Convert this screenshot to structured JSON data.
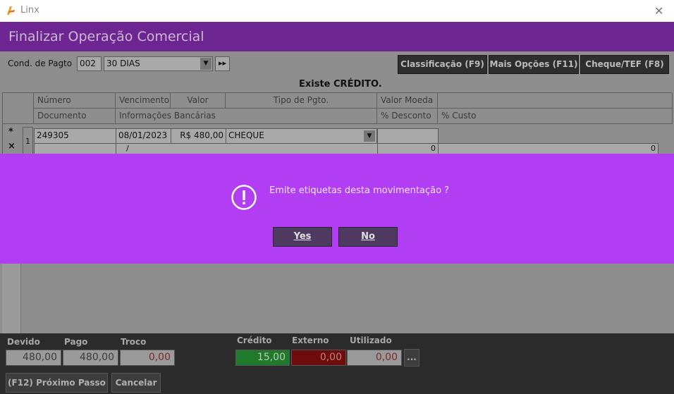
{
  "window": {
    "app_title": "Linx",
    "close_glyph": "✕",
    "logo_icon": "linx-logo-icon"
  },
  "header": {
    "title": "Finalizar Operação Comercial"
  },
  "toolbar": {
    "cond_label": "Cond. de Pagto",
    "cond_code": "002",
    "cond_value": "30 DIAS",
    "dropdown_glyph": "▼",
    "next_glyph": "▸▸",
    "buttons": [
      "Classificação (F9)",
      "Mais Opções (F11)",
      "Cheque/TEF (F8)"
    ]
  },
  "banner": "Existe CRÉDITO.",
  "table": {
    "headers_row1": [
      "Número",
      "Vencimento",
      "Valor",
      "Tipo de Pgto.",
      "Valor Moeda"
    ],
    "headers_row2": [
      "Documento",
      "Informações Bancárias",
      "% Desconto",
      "% Custo"
    ],
    "row": {
      "marker1": "*",
      "marker2": "×",
      "index": "1",
      "numero": "249305",
      "vencimento": "08/01/2023",
      "valor": "R$ 480,00",
      "tipo": "CHEQUE",
      "bank_sep": "/",
      "desconto": "0",
      "custo": "0"
    }
  },
  "dialog": {
    "message": "Emite etiquetas desta movimentação ?",
    "icon": "exclamation-icon",
    "yes": "Yes",
    "no": "No"
  },
  "footer": {
    "devido_label": "Devido",
    "devido": "480,00",
    "pago_label": "Pago",
    "pago": "480,00",
    "troco_label": "Troco",
    "troco": "0,00",
    "credito_label": "Crédito",
    "credito": "15,00",
    "externo_label": "Externo",
    "externo": "0,00",
    "utilizado_label": "Utilizado",
    "utilizado": "0,00",
    "ellipsis": "...",
    "next_step": "(F12) Próximo Passo",
    "cancel": "Cancelar"
  },
  "colors": {
    "header": "#6d2592",
    "dialog": "#b23ef4",
    "credito_bg": "#1f7a2c",
    "externo_bg": "#6e0b0b"
  }
}
